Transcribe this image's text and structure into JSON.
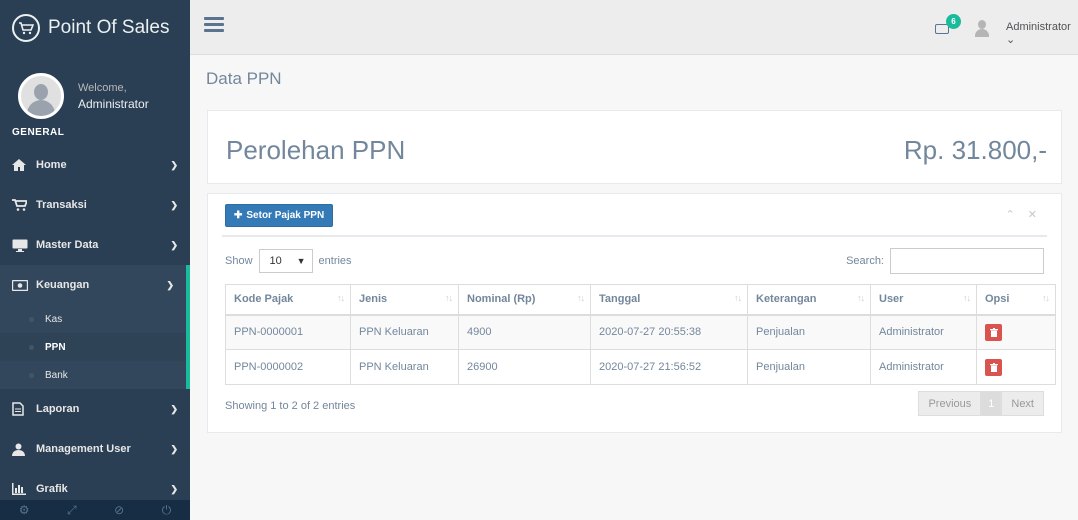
{
  "brand": {
    "title": "Point Of Sales"
  },
  "profile": {
    "welcome": "Welcome,",
    "name": "Administrator"
  },
  "sidebar": {
    "section": "GENERAL",
    "items": [
      {
        "label": "Home",
        "icon": "home-icon"
      },
      {
        "label": "Transaksi",
        "icon": "cart-icon"
      },
      {
        "label": "Master Data",
        "icon": "desktop-icon"
      },
      {
        "label": "Keuangan",
        "icon": "money-icon"
      },
      {
        "label": "Laporan",
        "icon": "file-icon"
      },
      {
        "label": "Management User",
        "icon": "user-icon"
      },
      {
        "label": "Grafik",
        "icon": "bar-chart-icon"
      }
    ],
    "submenu": [
      {
        "label": "Kas"
      },
      {
        "label": "PPN"
      },
      {
        "label": "Bank"
      }
    ]
  },
  "topnav": {
    "mail_count": "6",
    "user": "Administrator"
  },
  "page": {
    "title": "Data PPN"
  },
  "ppn": {
    "label": "Perolehan PPN",
    "value": "Rp. 31.800,-"
  },
  "table_panel": {
    "button": "Setor Pajak PPN",
    "show": "Show",
    "entries_value": "10",
    "entries": "entries",
    "search": "Search:",
    "columns": [
      "Kode Pajak",
      "Jenis",
      "Nominal (Rp)",
      "Tanggal",
      "Keterangan",
      "User",
      "Opsi"
    ],
    "rows": [
      [
        "PPN-0000001",
        "PPN Keluaran",
        "4900",
        "2020-07-27 20:55:38",
        "Penjualan",
        "Administrator"
      ],
      [
        "PPN-0000002",
        "PPN Keluaran",
        "26900",
        "2020-07-27 21:56:52",
        "Penjualan",
        "Administrator"
      ]
    ],
    "info": "Showing 1 to 2 of 2 entries",
    "pager": {
      "previous": "Previous",
      "current": "1",
      "next": "Next"
    }
  },
  "colors": {
    "sidebar": "#2a3f54",
    "accent": "#1abb9c",
    "primary": "#337ab7",
    "danger": "#d9534f"
  }
}
